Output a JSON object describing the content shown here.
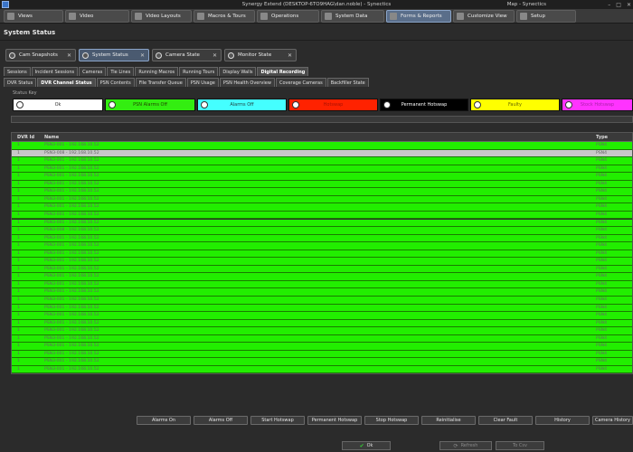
{
  "window": {
    "title": "Synergy Extend (DESKTOP-6TO9HAG\\dan.noble) - Synectics",
    "right_title": "Map - Synectics",
    "controls": [
      "–",
      "□",
      "✕"
    ]
  },
  "menu": {
    "tabs": [
      {
        "label": "Views",
        "icon": "views-icon"
      },
      {
        "label": "Video",
        "icon": "video-icon"
      },
      {
        "label": "Video Layouts",
        "icon": "layout-icon"
      },
      {
        "label": "Macros & Tours",
        "icon": "macros-icon"
      },
      {
        "label": "Operations",
        "icon": "operations-icon"
      },
      {
        "label": "System Data",
        "icon": "system-data-icon"
      },
      {
        "label": "Forms & Reports",
        "icon": "forms-icon",
        "active": true
      },
      {
        "label": "Customize View",
        "icon": "customize-icon"
      },
      {
        "label": "Setup",
        "icon": "setup-icon"
      }
    ]
  },
  "page": {
    "title": "System Status"
  },
  "panel_tabs": [
    {
      "label": "Cam Snapshots"
    },
    {
      "label": "System Status",
      "active": true
    },
    {
      "label": "Camera State"
    },
    {
      "label": "Monitor State"
    }
  ],
  "subtabs_row1": [
    "Sessions",
    "Incident Sessions",
    "Cameras",
    "Tie Lines",
    "Running Macros",
    "Running Tours",
    "Display Walls",
    "Digital Recording"
  ],
  "subtabs_row2": [
    "DVR Status",
    "DVR Channel Status",
    "PSN Contents",
    "File Transfer Queue",
    "PSN Usage",
    "PSN Health Overview",
    "Coverage Cameras",
    "Backfiller State"
  ],
  "status_key": {
    "label": "Status Key",
    "items": [
      {
        "label": "Ok",
        "color": "#ffffff",
        "text": "#333333"
      },
      {
        "label": "PSN Alarms Off",
        "color": "#33ee11",
        "text": "#224400"
      },
      {
        "label": "Alarms Off",
        "color": "#44ffff",
        "text": "#224444"
      },
      {
        "label": "Hotswap",
        "color": "#ff2200",
        "text": "#aa1100"
      },
      {
        "label": "Permanent Hotswap",
        "color": "#000000",
        "text": "#ffffff"
      },
      {
        "label": "Faulty",
        "color": "#ffff00",
        "text": "#666600"
      },
      {
        "label": "Stock Hotswap",
        "color": "#ff33ff",
        "text": "#aa22aa"
      }
    ]
  },
  "grid": {
    "columns": [
      "DVR Id",
      "Name",
      "Type"
    ],
    "rows": [
      {
        "id": "1",
        "name": "PSN3-001 - 192.168.10.52",
        "type": "PSN4"
      },
      {
        "id": "1",
        "name": "PSN3-008 - 192.168.10.52",
        "type": "PSN4",
        "selected": true
      },
      {
        "id": "1",
        "name": "PSN3-001 - 192.168.10.52",
        "type": "PSN4"
      },
      {
        "id": "1",
        "name": "PSN3-001 - 192.168.10.52",
        "type": "PSN4"
      },
      {
        "id": "1",
        "name": "PSN3-001 - 192.168.10.52",
        "type": "PSN4"
      },
      {
        "id": "1",
        "name": "PSN3-001 - 192.168.10.52",
        "type": "PSN4"
      },
      {
        "id": "1",
        "name": "PSN3-001 - 192.168.10.52",
        "type": "PSN4"
      },
      {
        "id": "1",
        "name": "PSN3-001 - 192.168.10.52",
        "type": "PSN4"
      },
      {
        "id": "1",
        "name": "PSN3-001 - 192.168.10.52",
        "type": "PSN4"
      },
      {
        "id": "1",
        "name": "PSN3-001 - 192.168.10.52",
        "type": "PSN4"
      },
      {
        "id": "1",
        "name": "PSN3-001 - 192.168.10.52",
        "type": "PSN4"
      },
      {
        "id": "1",
        "name": "PSN3-008 - 192.168.10.52",
        "type": "PSN4"
      },
      {
        "id": "1",
        "name": "PSN3-001 - 192.168.10.52",
        "type": "PSN4"
      },
      {
        "id": "1",
        "name": "PSN3-001 - 192.168.10.52",
        "type": "PSN4"
      },
      {
        "id": "1",
        "name": "PSN3-001 - 192.168.10.52",
        "type": "PSN4"
      },
      {
        "id": "1",
        "name": "PSN3-001 - 192.168.10.52",
        "type": "PSN4"
      },
      {
        "id": "1",
        "name": "PSN3-001 - 192.168.10.52",
        "type": "PSN4"
      },
      {
        "id": "1",
        "name": "PSN3-001 - 192.168.10.52",
        "type": "PSN4"
      },
      {
        "id": "1",
        "name": "PSN3-001 - 192.168.10.52",
        "type": "PSN4"
      },
      {
        "id": "1",
        "name": "PSN3-001 - 192.168.10.52",
        "type": "PSN4"
      },
      {
        "id": "1",
        "name": "PSN3-001 - 192.168.10.52",
        "type": "PSN4"
      },
      {
        "id": "1",
        "name": "PSN3-001 - 192.168.10.52",
        "type": "PSN4"
      },
      {
        "id": "1",
        "name": "PSN3-001 - 192.168.10.52",
        "type": "PSN4"
      },
      {
        "id": "1",
        "name": "PSN3-001 - 192.168.10.52",
        "type": "PSN4"
      },
      {
        "id": "1",
        "name": "PSN3-001 - 192.168.10.52",
        "type": "PSN4"
      },
      {
        "id": "1",
        "name": "PSN3-001 - 192.168.10.52",
        "type": "PSN4"
      },
      {
        "id": "1",
        "name": "PSN3-001 - 192.168.10.52",
        "type": "PSN4"
      },
      {
        "id": "1",
        "name": "PSN3-001 - 192.168.10.52",
        "type": "PSN4"
      },
      {
        "id": "1",
        "name": "PSN3-001 - 192.168.10.52",
        "type": "PSN4"
      },
      {
        "id": "1",
        "name": "PSN3-001 - 192.168.10.52",
        "type": "PSN4"
      }
    ],
    "row_color": "#22ee00",
    "selected_color": "#c8c8c8"
  },
  "actions": [
    "Alarms On",
    "Alarms Off",
    "Start Hotswap",
    "Permanent Hotswap",
    "Stop Hotswap",
    "Reinitialise",
    "Clear Fault",
    "History",
    "Camera History"
  ],
  "footer": {
    "ok": "Ok",
    "refresh": "Refresh",
    "to_csv": "To Csv"
  }
}
